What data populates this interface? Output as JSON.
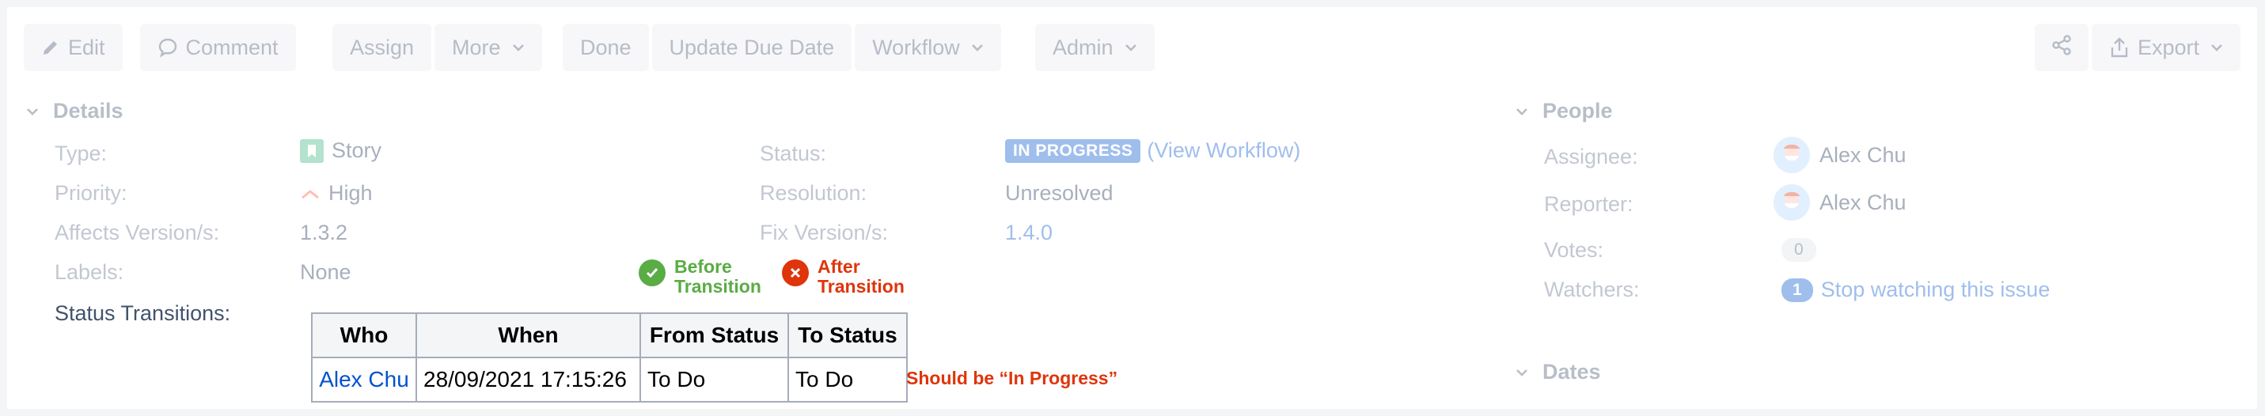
{
  "toolbar": {
    "edit": "Edit",
    "comment": "Comment",
    "assign": "Assign",
    "more": "More",
    "done": "Done",
    "update_due_date": "Update Due Date",
    "workflow": "Workflow",
    "admin": "Admin",
    "export": "Export"
  },
  "details": {
    "heading": "Details",
    "type_label": "Type:",
    "type_value": "Story",
    "priority_label": "Priority:",
    "priority_value": "High",
    "affects_label": "Affects Version/s:",
    "affects_value": "1.3.2",
    "labels_label": "Labels:",
    "labels_value": "None",
    "status_label": "Status:",
    "status_value": "IN PROGRESS",
    "view_workflow": "(View Workflow)",
    "resolution_label": "Resolution:",
    "resolution_value": "Unresolved",
    "fix_label": "Fix Version/s:",
    "fix_value": "1.4.0",
    "transitions_label": "Status Transitions:"
  },
  "legend": {
    "before_line1": "Before",
    "before_line2": "Transition",
    "after_line1": "After",
    "after_line2": "Transition",
    "before_color": "#5aac44",
    "after_color": "#de350b"
  },
  "transitions": {
    "headers": [
      "Who",
      "When",
      "From Status",
      "To Status"
    ],
    "rows": [
      {
        "who": "Alex Chu",
        "when": "28/09/2021 17:15:26",
        "from": "To Do",
        "to": "To Do"
      }
    ],
    "annotation": "Should be “In Progress”"
  },
  "people": {
    "heading": "People",
    "assignee_label": "Assignee:",
    "assignee_value": "Alex Chu",
    "reporter_label": "Reporter:",
    "reporter_value": "Alex Chu",
    "votes_label": "Votes:",
    "votes_value": "0",
    "watchers_label": "Watchers:",
    "watchers_count": "1",
    "watchers_link": "Stop watching this issue"
  },
  "dates": {
    "heading": "Dates"
  }
}
